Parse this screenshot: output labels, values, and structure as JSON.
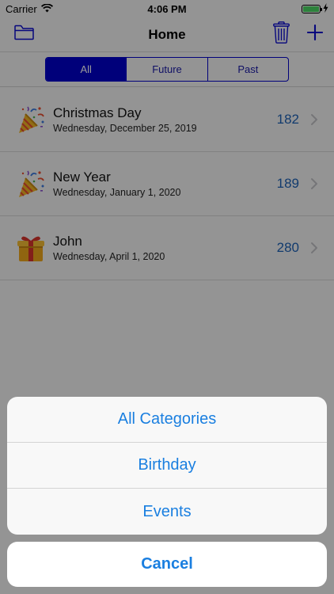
{
  "status_bar": {
    "carrier": "Carrier",
    "time": "4:06 PM",
    "battery_color": "#4cd964"
  },
  "nav": {
    "title": "Home",
    "left_icon": "folder-icon",
    "right_icons": [
      "trash-icon",
      "plus-icon"
    ],
    "accent_color": "#0a0ad0"
  },
  "segments": {
    "items": [
      "All",
      "Future",
      "Past"
    ],
    "selected": "All",
    "color": "#0000cc"
  },
  "events": [
    {
      "name": "Christmas Day",
      "date": "Wednesday, December 25, 2019",
      "count": "182",
      "icon": "party-popper-icon"
    },
    {
      "name": "New Year",
      "date": "Wednesday, January 1, 2020",
      "count": "189",
      "icon": "party-popper-icon"
    },
    {
      "name": "John",
      "date": "Wednesday, April 1, 2020",
      "count": "280",
      "icon": "gift-icon"
    }
  ],
  "action_sheet": {
    "options": [
      "All Categories",
      "Birthday",
      "Events"
    ],
    "cancel": "Cancel",
    "tint": "#1a7fe0"
  }
}
